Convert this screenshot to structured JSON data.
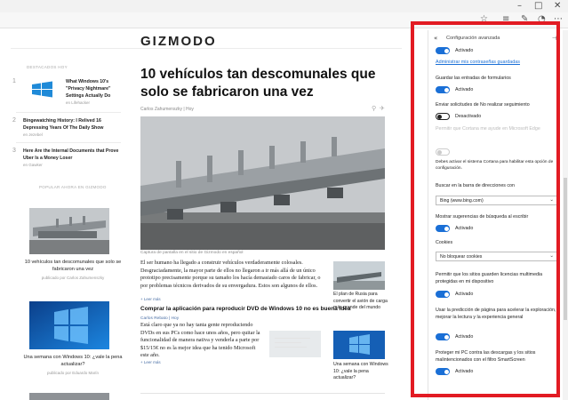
{
  "browser": {
    "window_controls": [
      "–",
      "□",
      "✕"
    ],
    "toolbar_icons": [
      "star-icon",
      "hub-icon",
      "note-icon",
      "share-icon",
      "more-icon"
    ]
  },
  "site": {
    "logo": "GIZMODO"
  },
  "sidebar": {
    "section_popular": "DESTACADOS HOY",
    "popular": [
      {
        "num": "1",
        "title": "What Windows 10's \"Privacy Nightmare\" Settings Actually Do",
        "by": "en Lifehacker"
      },
      {
        "num": "2",
        "title": "Bingewatching History: I Relived 16 Depressing Years Of The Daily Show",
        "by": "en Jezebel"
      },
      {
        "num": "3",
        "title": "Here Are the Internal Documents that Prove Uber Is a Money Loser",
        "by": "en Gawker"
      }
    ],
    "section_latest": "POPULAR AHORA EN GIZMODO",
    "cards": [
      {
        "title": "10 vehículos tan descomunales que solo se fabricaron una vez",
        "by": "publicado por Carlos Zahumenszky"
      },
      {
        "title": "Una semana con Windows 10: ¿vale la pena actualizar?",
        "by": "publicado por Eduardo Marín"
      }
    ]
  },
  "article": {
    "headline": "10 vehículos tan descomunales que solo se fabricaron una vez",
    "byline": "Carlos Zahumenszky | Hoy",
    "caption": "Captura de pantalla en el sitio de Gizmodo en español",
    "body": "El ser humano ha llegado a construir vehículos verdaderamente colosales. Desgraciadamente, la mayor parte de ellos no llegaron a ir más allá de un único prototipo precisamente porque su tamaño los hacía demasiado caros de fabricar, o por problemas técnicos derivados de su envergadura. Estos son algunos de ellos.",
    "more": "+ Leer más",
    "aside_caption": "El plan de Rusia para convertir el avión de carga más grande del mundo",
    "sub_headline": "Comprar la aplicación para reproducir DVD de Windows 10 no es buena idea",
    "sub_byline": "Carlos Rebato | Hoy",
    "sub_body": "Está claro que ya no hay tanta gente reproduciendo DVDs en sus PCs como hace unos años, pero quitar la funcionalidad de manera nativa y venderla a parte por $15/15€ no es la mejor idea que ha tenido Microsoft este año.",
    "sub_more": "+ Leer más",
    "aside_caption2": "Una semana con Windows 10: ¿vale la pena actualizar?"
  },
  "settings": {
    "title": "Configuración avanzada",
    "items": [
      {
        "type": "toggle",
        "state": "on",
        "label": "",
        "value": "Activado"
      },
      {
        "type": "link",
        "label": "Administrar mis contraseñas guardadas"
      },
      {
        "type": "toggle",
        "state": "on",
        "label": "Guardar las entradas de formularios",
        "value": "Activado"
      },
      {
        "type": "toggle",
        "state": "off",
        "label": "Enviar solicitudes de No realizar seguimiento",
        "value": "Desactivado"
      },
      {
        "type": "toggle",
        "state": "disabled",
        "label": "Permitir que Cortana me ayude en Microsoft Edge",
        "value": ""
      },
      {
        "type": "note",
        "label": "Debes activar el sistema Cortana para habilitar esta opción de configuración."
      },
      {
        "type": "select",
        "label": "Buscar en la barra de direcciones con",
        "value": "Bing (www.bing.com)"
      },
      {
        "type": "toggle",
        "state": "on",
        "label": "Mostrar sugerencias de búsqueda al escribir",
        "value": "Activado"
      },
      {
        "type": "select",
        "label": "Cookies",
        "value": "No bloquear cookies"
      },
      {
        "type": "toggle",
        "state": "on",
        "label": "Permitir que los sitios guarden licencias multimedia protegidas en mi dispositivo",
        "value": "Activado"
      },
      {
        "type": "toggle",
        "state": "on",
        "label": "Usar la predicción de página para acelerar la exploración, mejorar la lectura y la experiencia general",
        "value": "Activado"
      },
      {
        "type": "toggle",
        "state": "on",
        "label": "Proteger mi PC contra las descargas y los sitios malintencionados con el filtro SmartScreen",
        "value": "Activado"
      }
    ]
  },
  "colors": {
    "highlight": "#e21b23",
    "toggle_on": "#1a6fd6",
    "link": "#1a6fd6"
  }
}
